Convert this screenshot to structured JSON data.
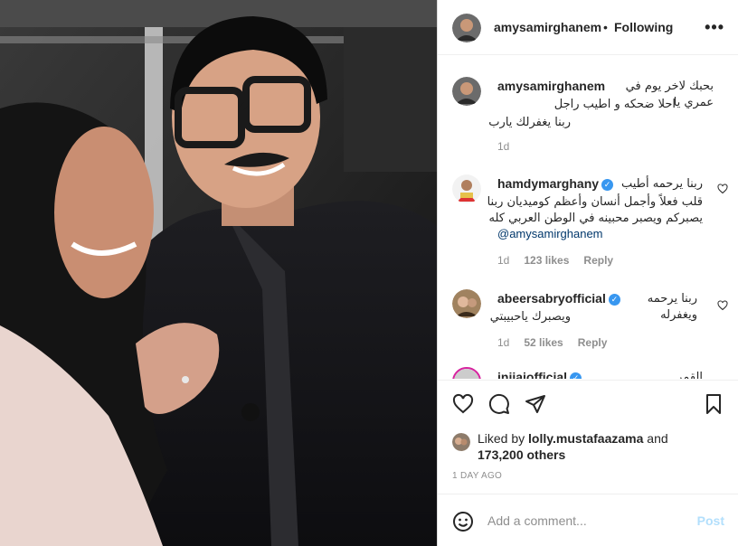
{
  "post": {
    "author": "amysamirghanem",
    "dot": "•",
    "follow_label": "Following",
    "more_icon": "more-options-icon"
  },
  "caption": {
    "username": "amysamirghanem",
    "line1": "بحبك لاخر يوم في عمري يا",
    "line2": "احلا ضحكه و اطيب راجل",
    "line3": "ربنا يغفرلك يارب",
    "time": "1d"
  },
  "comments": [
    {
      "username": "hamdymarghany",
      "lines": [
        "ربنا يرحمه أطيب",
        "قلب فعلاً وأجمل أنسان وأعظم كوميديان ربنا",
        "يصبركم ويصبر محبينه في الوطن العربي كله"
      ],
      "mention": "@amysamirghanem",
      "time": "1d",
      "likes": "123 likes",
      "reply": "Reply"
    },
    {
      "username": "abeersabryofficial",
      "lines": [
        "ربنا يرحمه ويغفرله",
        "ويصبرك ياحبيبتي"
      ],
      "time": "1d",
      "likes": "52 likes",
      "reply": "Reply"
    },
    {
      "username": "injiaiofficial",
      "lines": [
        "القمر"
      ]
    }
  ],
  "likes": {
    "prefix": "Liked by ",
    "user": "lolly.mustafaazama",
    "and": " and",
    "count": "173,200 others"
  },
  "timestamp": "1 DAY AGO",
  "add_comment": {
    "placeholder": "Add a comment...",
    "post_label": "Post"
  },
  "colors": {
    "verified": "#3897f0",
    "link": "#00376b",
    "muted": "#8e8e8e",
    "post_disabled": "#b2dffc"
  }
}
